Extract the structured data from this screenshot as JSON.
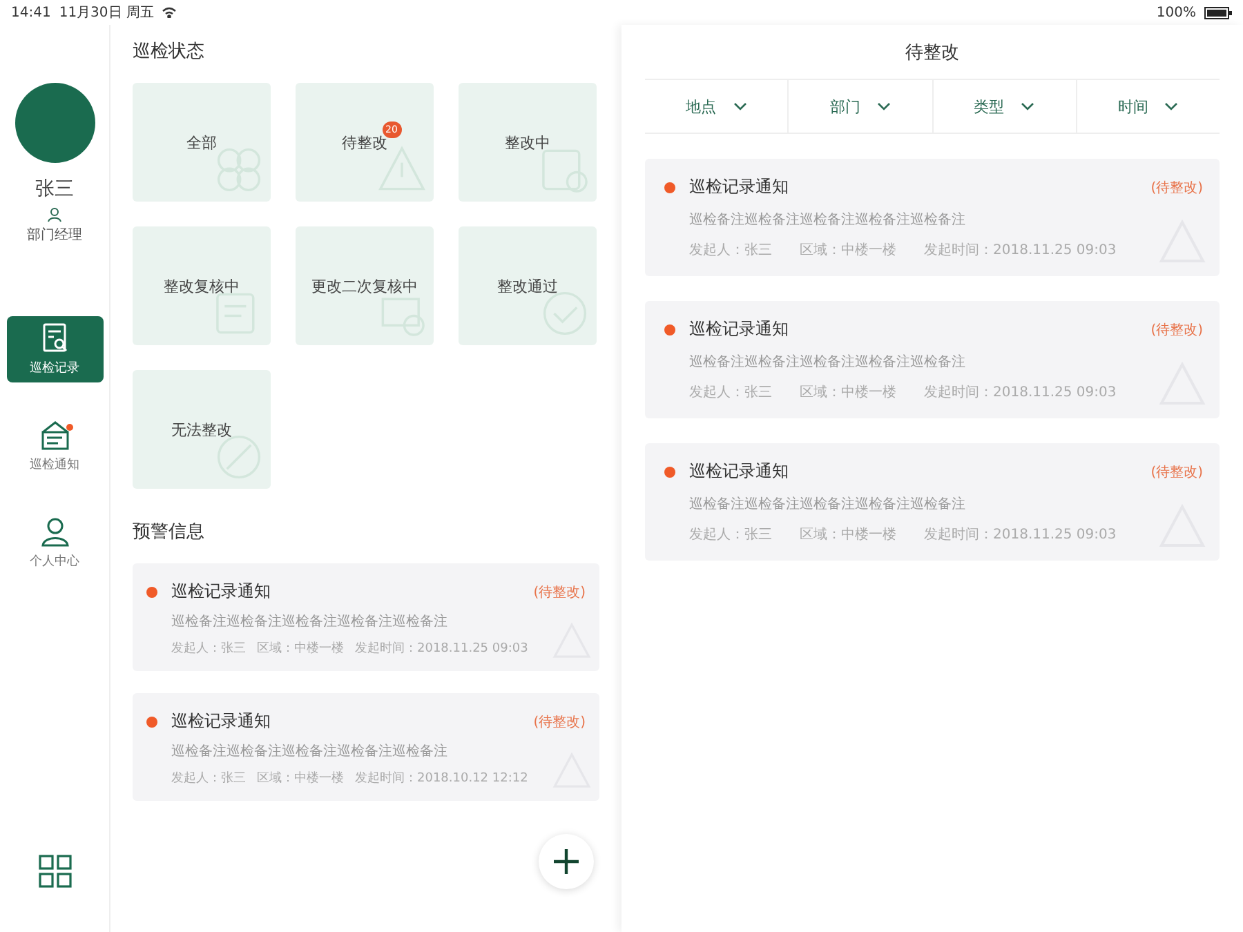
{
  "status_bar": {
    "time": "14:41",
    "date": "11月30日 周五",
    "battery": "100%"
  },
  "profile": {
    "name": "张三",
    "role": "部门经理"
  },
  "nav": [
    {
      "label": "巡检记录",
      "selected": true,
      "alert": false,
      "kind": "record"
    },
    {
      "label": "巡检通知",
      "selected": false,
      "alert": true,
      "kind": "notice"
    },
    {
      "label": "个人中心",
      "selected": false,
      "alert": false,
      "kind": "person"
    }
  ],
  "status_section": {
    "title": "巡检状态",
    "cards": [
      {
        "label": "全部"
      },
      {
        "label": "待整改",
        "badge": "20"
      },
      {
        "label": "整改中"
      },
      {
        "label": "整改复核中"
      },
      {
        "label": "更改二次复核中"
      },
      {
        "label": "整改通过"
      },
      {
        "label": "无法整改"
      }
    ]
  },
  "warning_section": {
    "title": "预警信息",
    "items": [
      {
        "title": "巡检记录通知",
        "tag": "(待整改)",
        "note": "巡检备注巡检备注巡检备注巡检备注巡检备注",
        "meta": [
          "发起人：张三",
          "区域：中楼一楼",
          "发起时间：2018.11.25 09:03"
        ]
      },
      {
        "title": "巡检记录通知",
        "tag": "(待整改)",
        "note": "巡检备注巡检备注巡检备注巡检备注巡检备注",
        "meta": [
          "发起人：张三",
          "区域：中楼一楼",
          "发起时间：2018.10.12 12:12"
        ]
      }
    ]
  },
  "detail": {
    "title": "待整改",
    "filters": [
      "地点",
      "部门",
      "类型",
      "时间"
    ],
    "items": [
      {
        "title": "巡检记录通知",
        "tag": "(待整改)",
        "note": "巡检备注巡检备注巡检备注巡检备注巡检备注",
        "meta": [
          "发起人：张三",
          "区域：中楼一楼",
          "发起时间：2018.11.25  09:03"
        ]
      },
      {
        "title": "巡检记录通知",
        "tag": "(待整改)",
        "note": "巡检备注巡检备注巡检备注巡检备注巡检备注",
        "meta": [
          "发起人：张三",
          "区域：中楼一楼",
          "发起时间：2018.11.25  09:03"
        ]
      },
      {
        "title": "巡检记录通知",
        "tag": "(待整改)",
        "note": "巡检备注巡检备注巡检备注巡检备注巡检备注",
        "meta": [
          "发起人：张三",
          "区域：中楼一楼",
          "发起时间：2018.11.25  09:03"
        ]
      }
    ]
  }
}
